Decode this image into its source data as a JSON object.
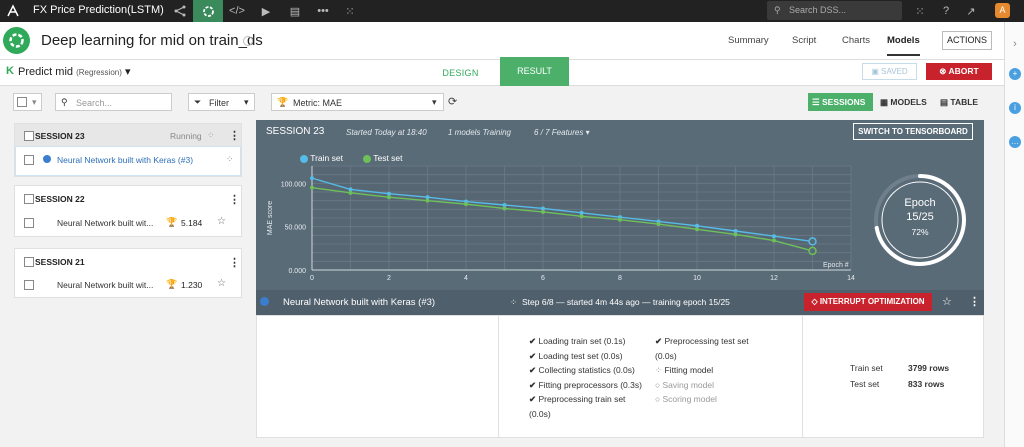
{
  "topbar": {
    "project_name": "FX Price Prediction(LSTM)",
    "search_placeholder": "Search DSS...",
    "avatar_initial": "A"
  },
  "header": {
    "title": "Deep learning for mid on train_ds",
    "tabs": [
      "Summary",
      "Script",
      "Charts",
      "Models"
    ],
    "active_tab": "Models",
    "actions_label": "ACTIONS"
  },
  "subheader": {
    "k_label": "K",
    "predict_label": "Predict mid",
    "predict_type": "(Regression)",
    "design_label": "DESIGN",
    "result_label": "RESULT",
    "saved_label": "SAVED",
    "abort_label": "ABORT"
  },
  "toolbar": {
    "search_placeholder": "Search...",
    "filter_label": "Filter",
    "metric_label": "Metric: MAE",
    "views": [
      "SESSIONS",
      "MODELS",
      "TABLE"
    ],
    "active_view": "SESSIONS"
  },
  "sessions": [
    {
      "title": "SESSION 23",
      "status": "Running",
      "models": [
        {
          "name": "Neural Network built with Keras (#3)",
          "score": "",
          "running": true
        }
      ]
    },
    {
      "title": "SESSION 22",
      "status": "",
      "models": [
        {
          "name": "Neural Network built wit...",
          "score": "5.184",
          "running": false
        }
      ]
    },
    {
      "title": "SESSION 21",
      "status": "",
      "models": [
        {
          "name": "Neural Network built wit...",
          "score": "1.230",
          "running": false
        }
      ]
    }
  ],
  "panel": {
    "title": "SESSION 23",
    "started": "Started Today at 18:40",
    "models_training": "1 models Training",
    "features": "6 / 7 Features",
    "tensorboard_label": "SWITCH TO TENSORBOARD",
    "epoch_label": "Epoch",
    "epoch_value": "15/25",
    "epoch_pct": "72%",
    "epoch_progress": 0.72
  },
  "chart_data": {
    "type": "line",
    "xlabel": "Epoch #",
    "ylabel": "MAE score",
    "xlim": [
      0,
      14
    ],
    "ylim": [
      0,
      120000
    ],
    "xticks": [
      0,
      2,
      4,
      6,
      8,
      10,
      12,
      14
    ],
    "yticks": [
      0,
      50000,
      100000
    ],
    "ytick_labels": [
      "0.000",
      "50.000",
      "100.000"
    ],
    "series": [
      {
        "name": "Train set",
        "color": "#56bbe6",
        "x": [
          0,
          1,
          2,
          3,
          4,
          5,
          6,
          7,
          8,
          9,
          10,
          11,
          12,
          13
        ],
        "values": [
          106000,
          93000,
          88000,
          84000,
          79000,
          75000,
          71000,
          66000,
          61000,
          56000,
          51000,
          45000,
          39000,
          33000
        ]
      },
      {
        "name": "Test set",
        "color": "#6dc05a",
        "x": [
          0,
          1,
          2,
          3,
          4,
          5,
          6,
          7,
          8,
          9,
          10,
          11,
          12,
          13
        ],
        "values": [
          95000,
          89000,
          84000,
          80000,
          76000,
          71000,
          67000,
          62000,
          58000,
          53000,
          47000,
          41000,
          34000,
          22000
        ]
      }
    ]
  },
  "model_bar": {
    "name": "Neural Network built with Keras (#3)",
    "step_text": "Step 6/8 — started 4m 44s ago — training epoch 15/25",
    "interrupt_label": "INTERRUPT OPTIMIZATION"
  },
  "steps_left": [
    {
      "label": "Loading train set (0.1s)",
      "state": "done"
    },
    {
      "label": "Loading test set (0.0s)",
      "state": "done"
    },
    {
      "label": "Collecting statistics (0.0s)",
      "state": "done"
    },
    {
      "label": "Fitting preprocessors (0.3s)",
      "state": "done"
    },
    {
      "label": "Preprocessing train set",
      "state": "done"
    },
    {
      "label": "(0.0s)",
      "state": "cont"
    }
  ],
  "steps_right": [
    {
      "label": "Preprocessing test set",
      "state": "done"
    },
    {
      "label": "(0.0s)",
      "state": "cont"
    },
    {
      "label": "Fitting model",
      "state": "running"
    },
    {
      "label": "Saving model",
      "state": "pending"
    },
    {
      "label": "Scoring model",
      "state": "pending"
    }
  ],
  "dataset_info": {
    "train_label": "Train set",
    "train_rows": "3799 rows",
    "test_label": "Test set",
    "test_rows": "833 rows"
  },
  "colors": {
    "accent_green": "#4caf6a",
    "danger_red": "#c8232c",
    "panel_bg": "#5a6b78",
    "train": "#56bbe6",
    "test": "#6dc05a"
  }
}
